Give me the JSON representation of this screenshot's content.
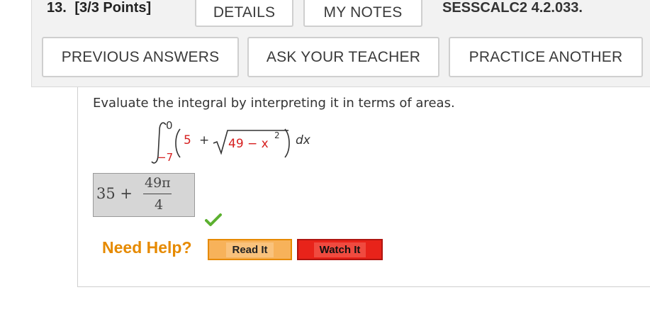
{
  "question": {
    "number_label": "13.",
    "points_label": "[3/3 Points]",
    "reference": "SESSCALC2 4.2.033."
  },
  "tabs": {
    "details": "DETAILS",
    "my_notes": "MY NOTES"
  },
  "actions": {
    "previous_answers": "PREVIOUS ANSWERS",
    "ask_teacher": "ASK YOUR TEACHER",
    "practice_another": "PRACTICE ANOTHER"
  },
  "problem": {
    "prompt": "Evaluate the integral by interpreting it in terms of areas.",
    "upper_limit": "0",
    "lower_limit": "−7",
    "integrand_const": "5",
    "plus": "+",
    "radicand": "49 − x",
    "exponent": "2",
    "dx": "dx"
  },
  "answer": {
    "whole": "35 +",
    "numerator": "49π",
    "denominator": "4",
    "status": "correct"
  },
  "help": {
    "label": "Need Help?",
    "read_it": "Read It",
    "watch_it": "Watch It"
  },
  "colors": {
    "help_orange": "#e68a00",
    "correct_green": "#5cb030",
    "watch_red": "#e8231a",
    "limit_red": "#d62020"
  }
}
